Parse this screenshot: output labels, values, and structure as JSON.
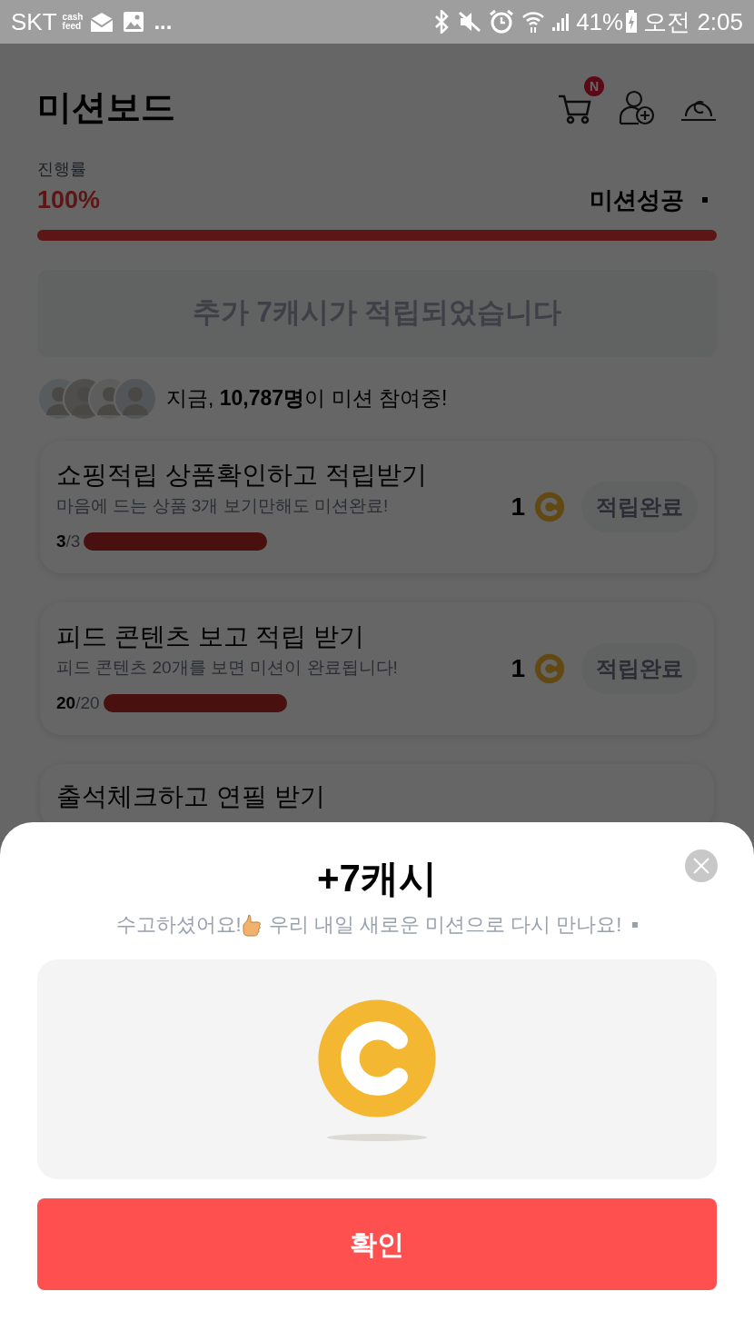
{
  "status_bar": {
    "carrier": "SKT",
    "app_logo": [
      "cash",
      "feed"
    ],
    "more": "...",
    "battery": "41%",
    "time": "오전 2:05"
  },
  "header": {
    "title": "미션보드",
    "cart_badge": "N"
  },
  "progress": {
    "label": "진행률",
    "percent": "100%",
    "status": "미션성공",
    "level": 1
  },
  "banner": "추가 7캐시가 적립되었습니다",
  "participants": "지금, **10,787명**이 미션 참여중!",
  "missions": [
    {
      "title": "쇼핑적립 상품확인하고 적립받기",
      "description": "마음에 드는 상품 3개 보기만해도 미션완료!",
      "done": "3",
      "total": "/3",
      "level": 1,
      "reward": "1",
      "button": "적립완료"
    },
    {
      "title": "피드 콘텐츠 보고 적립 받기",
      "description": "피드 콘텐츠 20개를 보면 미션이 완료됩니다!",
      "done": "20",
      "total": "/20",
      "level": 1,
      "reward": "1",
      "button": "적립완료"
    },
    {
      "title": "출석체크하고 연필 받기"
    }
  ],
  "sheet": {
    "title": "+7캐시",
    "message_start": "수고하셨어요!",
    "message_end": "우리 내일 새로운 미션으로 다시 만나요!",
    "confirm": "확인"
  }
}
